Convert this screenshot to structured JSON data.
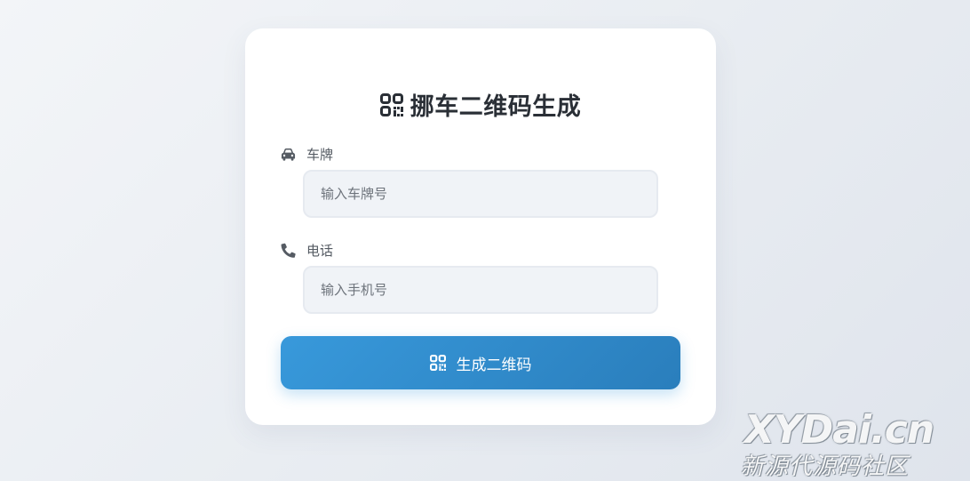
{
  "form": {
    "title": "挪车二维码生成",
    "title_icon": "qrcode-icon",
    "plate": {
      "label": "车牌",
      "icon": "car-icon",
      "placeholder": "输入车牌号",
      "value": ""
    },
    "phone": {
      "label": "电话",
      "icon": "phone-icon",
      "placeholder": "输入手机号",
      "value": ""
    },
    "submit": {
      "label": "生成二维码",
      "icon": "qrcode-icon"
    }
  },
  "watermark": {
    "line1": "XYDai.cn",
    "line2": "新源代源码社区"
  },
  "colors": {
    "accent": "#3498db",
    "accent_dark": "#2980b9",
    "title_text": "#2a2f36",
    "input_bg": "#f0f3f7"
  }
}
